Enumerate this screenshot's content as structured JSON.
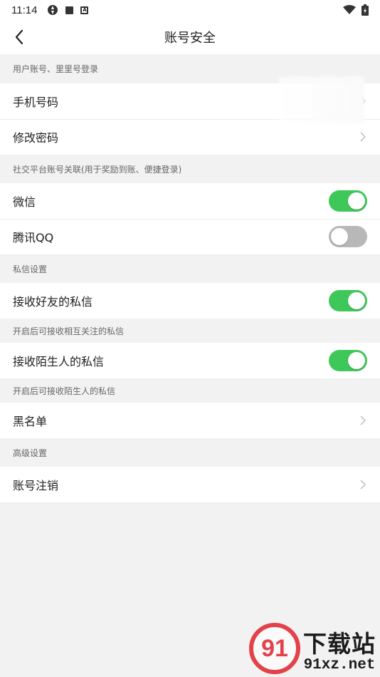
{
  "status_bar": {
    "time": "11:14"
  },
  "nav": {
    "title": "账号安全"
  },
  "sections": {
    "login": {
      "header": "用户账号、里里号登录",
      "phone_label": "手机号码",
      "password_label": "修改密码"
    },
    "social": {
      "header": "社交平台账号关联(用于奖励到账、便捷登录)",
      "wechat_label": "微信",
      "wechat_on": true,
      "qq_label": "腾讯QQ",
      "qq_on": false
    },
    "messages": {
      "header": "私信设置",
      "friends_label": "接收好友的私信",
      "friends_on": true,
      "friends_hint": "开启后可接收相互关注的私信",
      "strangers_label": "接收陌生人的私信",
      "strangers_on": true,
      "strangers_hint": "开启后可接收陌生人的私信",
      "blacklist_label": "黑名单"
    },
    "advanced": {
      "header": "高级设置",
      "cancel_label": "账号注销"
    }
  },
  "watermark": {
    "logo": "91",
    "text_cn": "下载站",
    "url": "91xz.net"
  },
  "colors": {
    "toggle_on": "#3ec85a",
    "toggle_off": "#b8b8b8",
    "background": "#f2f2f2"
  }
}
